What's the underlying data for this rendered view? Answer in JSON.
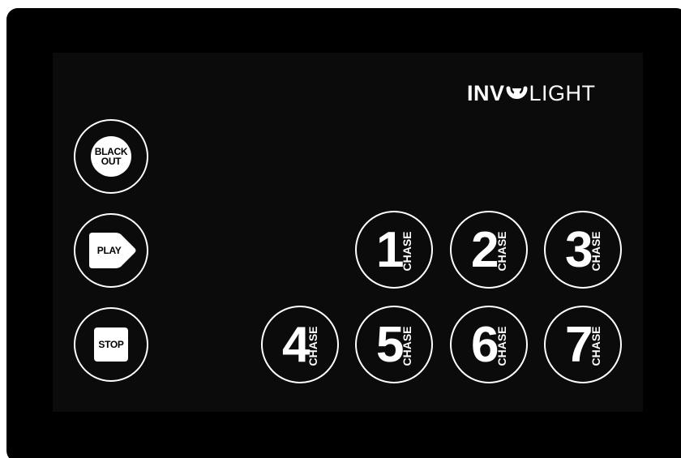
{
  "brand": {
    "logo_left": "INV",
    "logo_right": "LIGHT",
    "mark_icon": "involight-swirl-icon"
  },
  "controls": {
    "blackout": "BLACK\nOUT",
    "play": "PLAY",
    "stop": "STOP"
  },
  "chase_word": "CHASE",
  "chases": [
    {
      "number": "1"
    },
    {
      "number": "2"
    },
    {
      "number": "3"
    },
    {
      "number": "4"
    },
    {
      "number": "5"
    },
    {
      "number": "6"
    },
    {
      "number": "7"
    }
  ],
  "colors": {
    "background": "#000000",
    "foreground": "#ffffff"
  }
}
